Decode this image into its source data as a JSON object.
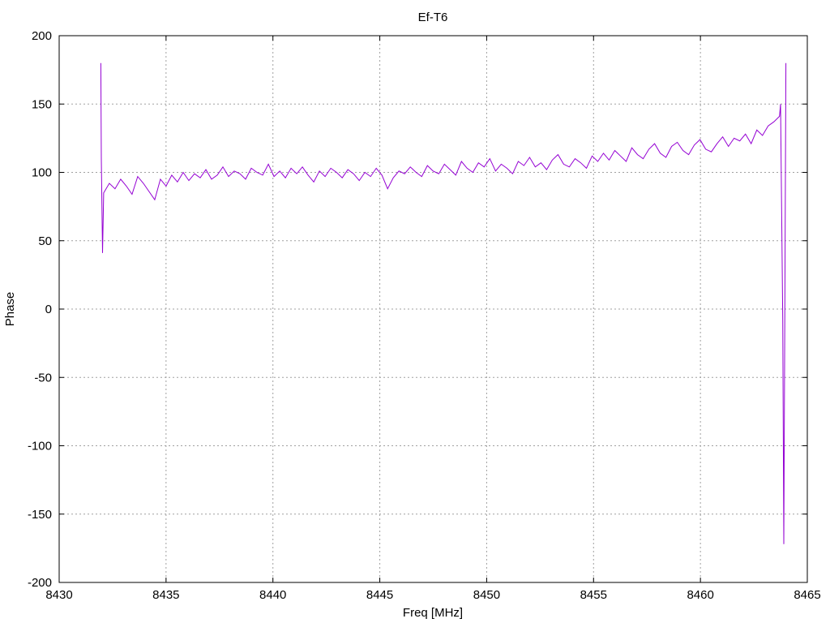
{
  "chart_data": {
    "type": "line",
    "title": "Ef-T6",
    "xlabel": "Freq [MHz]",
    "ylabel": "Phase",
    "xlim": [
      8430,
      8465
    ],
    "ylim": [
      -200,
      200
    ],
    "xticks": [
      8430,
      8435,
      8440,
      8445,
      8450,
      8455,
      8460,
      8465
    ],
    "yticks": [
      -200,
      -150,
      -100,
      -50,
      0,
      50,
      100,
      150,
      200
    ],
    "grid": true,
    "series": [
      {
        "name": "phase",
        "color": "#9400d3",
        "start_points": {
          "x": [
            8431.95,
            8431.97,
            8432.03
          ],
          "y": [
            180,
            110,
            41
          ]
        },
        "x_start": 8432.08,
        "x_end": 8463.7,
        "y": [
          85,
          92,
          88,
          95,
          90,
          84,
          97,
          92,
          86,
          80,
          95,
          90,
          98,
          93,
          100,
          94,
          99,
          96,
          102,
          95,
          98,
          104,
          97,
          101,
          99,
          95,
          103,
          100,
          98,
          106,
          97,
          101,
          96,
          103,
          99,
          104,
          98,
          93,
          101,
          97,
          103,
          100,
          96,
          102,
          99,
          94,
          100,
          97,
          103,
          98,
          88,
          96,
          101,
          99,
          104,
          100,
          97,
          105,
          101,
          99,
          106,
          102,
          98,
          108,
          103,
          100,
          107,
          104,
          110,
          101,
          106,
          103,
          99,
          108,
          105,
          111,
          104,
          107,
          102,
          109,
          113,
          106,
          104,
          110,
          107,
          103,
          112,
          108,
          114,
          109,
          116,
          112,
          108,
          118,
          113,
          110,
          117,
          121,
          114,
          111,
          119,
          122,
          116,
          113,
          120,
          124,
          117,
          115,
          121,
          126,
          119,
          125,
          123,
          128,
          121,
          131,
          127,
          134,
          137,
          141
        ],
        "end_points": {
          "x": [
            8463.75,
            8463.85,
            8463.9,
            8463.95,
            8464.0
          ],
          "y": [
            150,
            -8,
            -172,
            3,
            180
          ]
        }
      }
    ]
  }
}
